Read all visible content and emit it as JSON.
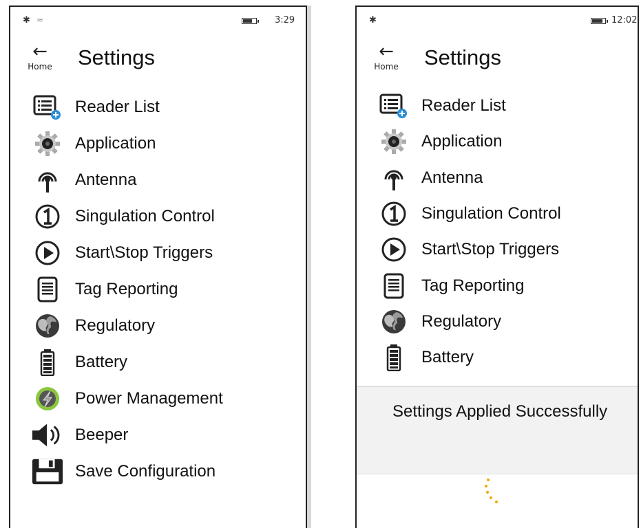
{
  "left_screen": {
    "status": {
      "time": "3:29",
      "battery_level": 0.7
    },
    "back_label": "Home",
    "title": "Settings",
    "items": [
      {
        "label": "Reader List",
        "icon": "reader-list-icon"
      },
      {
        "label": "Application",
        "icon": "gear-icon"
      },
      {
        "label": "Antenna",
        "icon": "antenna-icon"
      },
      {
        "label": "Singulation Control",
        "icon": "number-one-icon"
      },
      {
        "label": "Start\\Stop Triggers",
        "icon": "play-icon"
      },
      {
        "label": "Tag Reporting",
        "icon": "report-icon"
      },
      {
        "label": "Regulatory",
        "icon": "globe-icon"
      },
      {
        "label": "Battery",
        "icon": "battery-icon"
      },
      {
        "label": "Power Management",
        "icon": "power-icon"
      },
      {
        "label": "Beeper",
        "icon": "speaker-icon"
      },
      {
        "label": "Save Configuration",
        "icon": "save-icon"
      }
    ]
  },
  "right_screen": {
    "status": {
      "time": "12:02",
      "battery_level": 0.8
    },
    "back_label": "Home",
    "title": "Settings",
    "items": [
      {
        "label": "Reader List",
        "icon": "reader-list-icon"
      },
      {
        "label": "Application",
        "icon": "gear-icon"
      },
      {
        "label": "Antenna",
        "icon": "antenna-icon"
      },
      {
        "label": "Singulation Control",
        "icon": "number-one-icon"
      },
      {
        "label": "Start\\Stop Triggers",
        "icon": "play-icon"
      },
      {
        "label": "Tag Reporting",
        "icon": "report-icon"
      },
      {
        "label": "Regulatory",
        "icon": "globe-icon"
      },
      {
        "label": "Battery",
        "icon": "battery-icon"
      }
    ],
    "toast": {
      "message": "Settings Applied Successfully"
    },
    "accent_color": "#f0a800"
  }
}
